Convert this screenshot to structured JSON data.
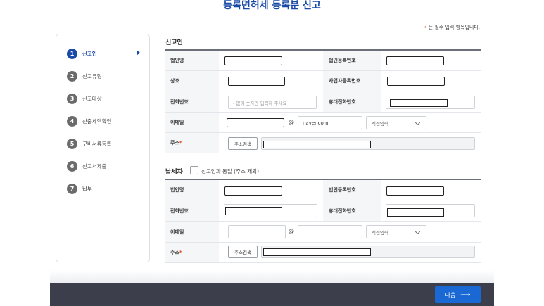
{
  "page_title": "등록면허세 등록분 신고",
  "required_note": {
    "star": "•",
    "text": "는 필수 입력 항목입니다."
  },
  "steps": [
    {
      "num": "1",
      "label": "신고인",
      "active": true
    },
    {
      "num": "2",
      "label": "신고유형"
    },
    {
      "num": "3",
      "label": "신고대상"
    },
    {
      "num": "4",
      "label": "산출세액확인"
    },
    {
      "num": "5",
      "label": "구비서류등록"
    },
    {
      "num": "6",
      "label": "신고서제출"
    },
    {
      "num": "7",
      "label": "납부"
    }
  ],
  "reporter": {
    "title": "신고인",
    "corp_name_label": "법인명",
    "corp_reg_label": "법인등록번호",
    "trade_name_label": "상호",
    "biz_reg_label": "사업자등록번호",
    "phone_label": "전화번호",
    "phone_placeholder": "- 없이 숫자만 입력해 주세요",
    "mobile_label": "휴대전화번호",
    "email_label": "이메일",
    "at": "@",
    "email_domain": "naver.com",
    "email_select": "직접입력",
    "address_label": "주소",
    "address_required": "*",
    "address_button": "주소검색"
  },
  "taxpayer": {
    "title": "납세자",
    "same_as_label": "신고인과 동일 (주소 제외)",
    "corp_name_label": "법인명",
    "corp_reg_label": "법인등록번호",
    "phone_label": "전화번호",
    "mobile_label": "휴대전화번호",
    "email_label": "이메일",
    "at": "@",
    "email_select": "직접입력",
    "address_label": "주소",
    "address_required": "*",
    "address_button": "주소검색"
  },
  "footer": {
    "next_label": "다음",
    "next_arrow": "⟶"
  }
}
